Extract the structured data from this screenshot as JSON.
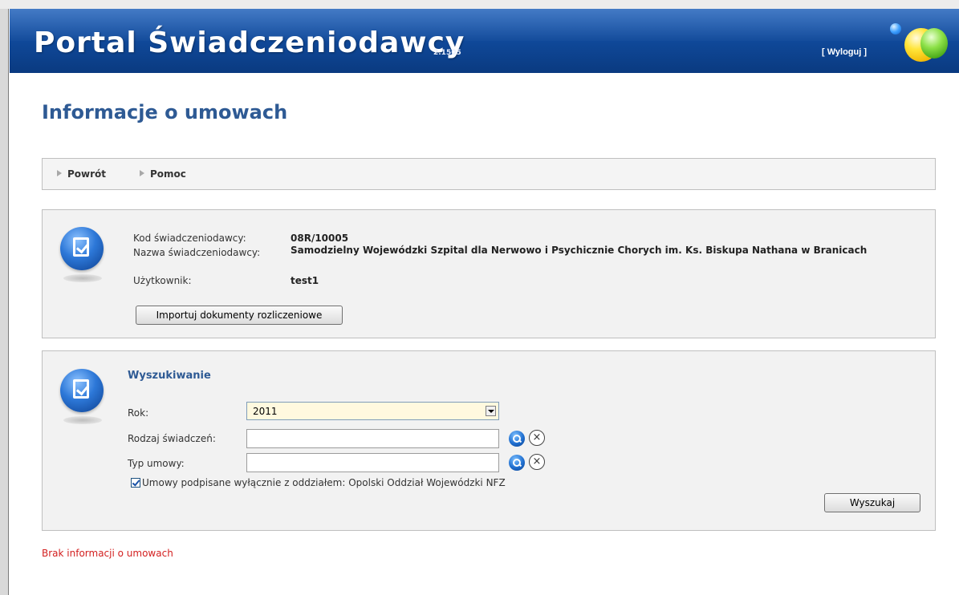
{
  "header": {
    "app_title": "Portal Świadczeniodawcy",
    "version": "2.1505",
    "logout": "[ Wyloguj ]"
  },
  "page": {
    "title": "Informacje o umowach"
  },
  "nav": {
    "back": "Powrót",
    "help": "Pomoc"
  },
  "provider": {
    "code_label": "Kod świadczeniodawcy:",
    "code_value": "08R/10005",
    "name_label": "Nazwa świadczeniodawcy:",
    "name_value": "Samodzielny Wojewódzki Szpital dla Nerwowo i Psychicznie Chorych im. Ks. Biskupa Nathana w Branicach",
    "user_label": "Użytkownik:",
    "user_value": "test1",
    "import_button": "Importuj dokumenty rozliczeniowe"
  },
  "search": {
    "title": "Wyszukiwanie",
    "year_label": "Rok:",
    "year_value": "2011",
    "service_type_label": "Rodzaj świadczeń:",
    "service_type_value": "",
    "contract_type_label": "Typ umowy:",
    "contract_type_value": "",
    "checkbox_label": "Umowy podpisane wyłącznie z oddziałem: Opolski Oddział Wojewódzki NFZ",
    "checkbox_checked": true,
    "search_button": "Wyszukaj"
  },
  "status": {
    "no_info": "Brak informacji o umowach"
  },
  "colors": {
    "header_blue": "#104a9c",
    "title_blue": "#2e5a94",
    "error_red": "#d32020"
  },
  "icons": [
    "document-check-icon",
    "document-edit-icon",
    "search-icon",
    "clear-icon",
    "nav-arrow-icon",
    "checkbox-icon"
  ]
}
